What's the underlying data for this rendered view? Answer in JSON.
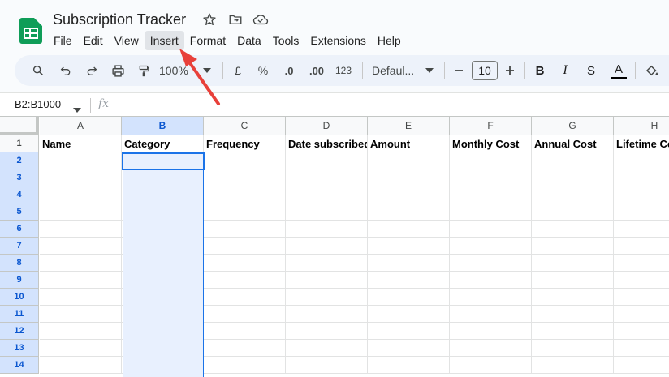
{
  "doc": {
    "title": "Subscription Tracker"
  },
  "icons": {
    "star": "star-icon",
    "move": "folder-move-icon",
    "cloud": "cloud-status-icon"
  },
  "menu": [
    {
      "label": "File"
    },
    {
      "label": "Edit"
    },
    {
      "label": "View"
    },
    {
      "label": "Insert",
      "active": true
    },
    {
      "label": "Format"
    },
    {
      "label": "Data"
    },
    {
      "label": "Tools"
    },
    {
      "label": "Extensions"
    },
    {
      "label": "Help"
    }
  ],
  "toolbar": {
    "zoom": "100%",
    "currency": "£",
    "percent": "%",
    "dec_decrease": ".0",
    "dec_increase": ".00",
    "number_format": "123",
    "font": "Defaul...",
    "font_size": "10",
    "bold": "B",
    "italic": "I",
    "strike": "S",
    "text_color": "A"
  },
  "formula_bar": {
    "name_box": "B2:B1000",
    "fx": "fx"
  },
  "grid": {
    "columns": [
      "A",
      "B",
      "C",
      "D",
      "E",
      "F",
      "G",
      "H"
    ],
    "selected_column": "B",
    "rows": [
      "1",
      "2",
      "3",
      "4",
      "5",
      "6",
      "7",
      "8",
      "9",
      "10",
      "11",
      "12",
      "13",
      "14"
    ],
    "header_row": [
      "Name",
      "Category",
      "Frequency",
      "Date subscribed",
      "Amount",
      "Monthly Cost",
      "Annual Cost",
      "Lifetime Cost"
    ]
  },
  "colors": {
    "accent": "#1a73e8",
    "selection": "#e8f0fe",
    "arrow": "#e8403a",
    "logo": "#0f9d58"
  }
}
